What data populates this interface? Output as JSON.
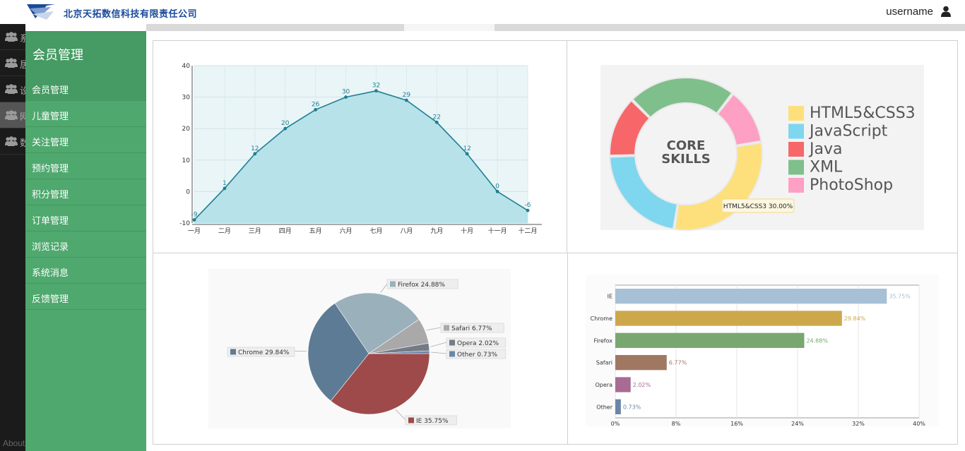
{
  "header": {
    "company": "北京天拓数信科技有限责任公司",
    "username": "username",
    "user_icon": "user-icon",
    "logo_icon": "company-logo"
  },
  "dark_nav": {
    "items": [
      {
        "label": "系",
        "icon": "users-icon"
      },
      {
        "label": "居",
        "icon": "users-icon"
      },
      {
        "label": "设",
        "icon": "users-icon"
      },
      {
        "label": "网",
        "icon": "users-icon",
        "active": true
      },
      {
        "label": "数",
        "icon": "users-icon"
      }
    ],
    "about": "About"
  },
  "menu": {
    "title": "会员管理",
    "items": [
      "会员管理",
      "儿童管理",
      "关注管理",
      "预约管理",
      "积分管理",
      "订单管理",
      "浏览记录",
      "系统消息",
      "反馈管理"
    ],
    "selected_index": 0
  },
  "chart_data": [
    {
      "type": "area",
      "categories": [
        "一月",
        "二月",
        "三月",
        "四月",
        "五月",
        "六月",
        "七月",
        "八月",
        "九月",
        "十月",
        "十一月",
        "十二月"
      ],
      "values": [
        -9,
        1,
        12,
        20,
        26,
        30,
        32,
        29,
        22,
        12,
        0,
        -6
      ],
      "ylim": [
        -10,
        40
      ],
      "yticks": [
        -10,
        0,
        10,
        20,
        30,
        40
      ],
      "grid": true,
      "colors": {
        "line": "#1f7f91",
        "fill": "#b7e2ea",
        "bg": "#eaf5f7"
      }
    },
    {
      "type": "pie",
      "title": "CORE SKILLS",
      "donut": true,
      "series": [
        {
          "name": "HTML5&CSS3",
          "value": 30,
          "color": "#fde07c"
        },
        {
          "name": "JavaScript",
          "value": 22,
          "color": "#7fd6ef"
        },
        {
          "name": "Java",
          "value": 13,
          "color": "#f7676a"
        },
        {
          "name": "XML",
          "value": 23,
          "color": "#7fbf8c"
        },
        {
          "name": "PhotoShop",
          "value": 12,
          "color": "#fda0c3"
        }
      ],
      "tooltip": "HTML5&CSS3 30.00%",
      "legend": "right"
    },
    {
      "type": "pie",
      "series": [
        {
          "name": "IE",
          "value": 35.75,
          "color": "#9e4a4a",
          "label": "IE 35.75%"
        },
        {
          "name": "Chrome",
          "value": 29.84,
          "color": "#5e7b95",
          "label": "Chrome 29.84%"
        },
        {
          "name": "Firefox",
          "value": 24.88,
          "color": "#9ab1bc",
          "label": "Firefox 24.88%"
        },
        {
          "name": "Safari",
          "value": 6.77,
          "color": "#a9a9a9",
          "label": "Safari 6.77%"
        },
        {
          "name": "Opera",
          "value": 2.02,
          "color": "#737b86",
          "label": "Opera 2.02%"
        },
        {
          "name": "Other",
          "value": 0.73,
          "color": "#6a86a8",
          "label": "Other 0.73%"
        }
      ]
    },
    {
      "type": "bar",
      "orientation": "horizontal",
      "categories": [
        "IE",
        "Chrome",
        "Firefox",
        "Safari",
        "Opera",
        "Other"
      ],
      "values": [
        35.75,
        29.84,
        24.88,
        6.77,
        2.02,
        0.73
      ],
      "value_labels": [
        "35.75%",
        "29.84%",
        "24.88%",
        "6.77%",
        "2.02%",
        "0.73%"
      ],
      "colors": [
        "#a6c0d6",
        "#cda84b",
        "#78a870",
        "#a07862",
        "#a86c94",
        "#6a86a8"
      ],
      "xlim": [
        0,
        40
      ],
      "xticks": [
        "0%",
        "8%",
        "16%",
        "24%",
        "32%",
        "40%"
      ],
      "grid": true
    }
  ]
}
